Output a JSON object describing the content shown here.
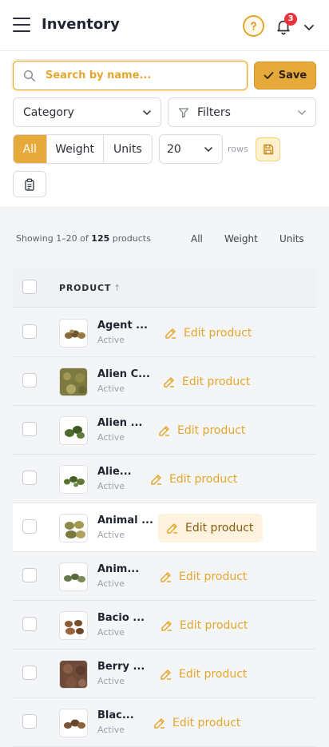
{
  "header": {
    "title": "Inventory",
    "notification_count": "3",
    "accent": "#e8a93b"
  },
  "toolbar": {
    "search_placeholder": "Search by name...",
    "save_label": "Save",
    "category_label": "Category",
    "filters_label": "Filters",
    "view_options": [
      "All",
      "Weight",
      "Units"
    ],
    "active_view": "All",
    "rows_value": "20",
    "rows_label": "rows"
  },
  "summary": {
    "prefix": "Showing 1–20 of",
    "total": "125",
    "suffix": "products",
    "quick_filters": [
      "All",
      "Weight",
      "Units"
    ]
  },
  "table": {
    "column_header": "PRODUCT",
    "sort_indicator": "↑",
    "rows": [
      {
        "name": "Agent ...",
        "status": "Active",
        "action": "Edit product",
        "thumb": "nuggets-brown"
      },
      {
        "name": "Alien C...",
        "status": "Active",
        "action": "Edit product",
        "thumb": "bud-closeup-olive"
      },
      {
        "name": "Alien ...",
        "status": "Active",
        "action": "Edit product",
        "thumb": "nuggets-green"
      },
      {
        "name": "Alie...",
        "status": "Active",
        "action": "Edit product",
        "thumb": "nuggets-green"
      },
      {
        "name": "Animal ...",
        "status": "Active",
        "action": "Edit product",
        "thumb": "nuggets-olive"
      },
      {
        "name": "Anim...",
        "status": "Active",
        "action": "Edit product",
        "thumb": "nuggets-green"
      },
      {
        "name": "Bacio ...",
        "status": "Active",
        "action": "Edit product",
        "thumb": "nuggets-brown"
      },
      {
        "name": "Berry ...",
        "status": "Active",
        "action": "Edit product",
        "thumb": "bud-closeup-brown"
      },
      {
        "name": "Blac...",
        "status": "Active",
        "action": "Edit product",
        "thumb": "nuggets-brown"
      }
    ]
  }
}
